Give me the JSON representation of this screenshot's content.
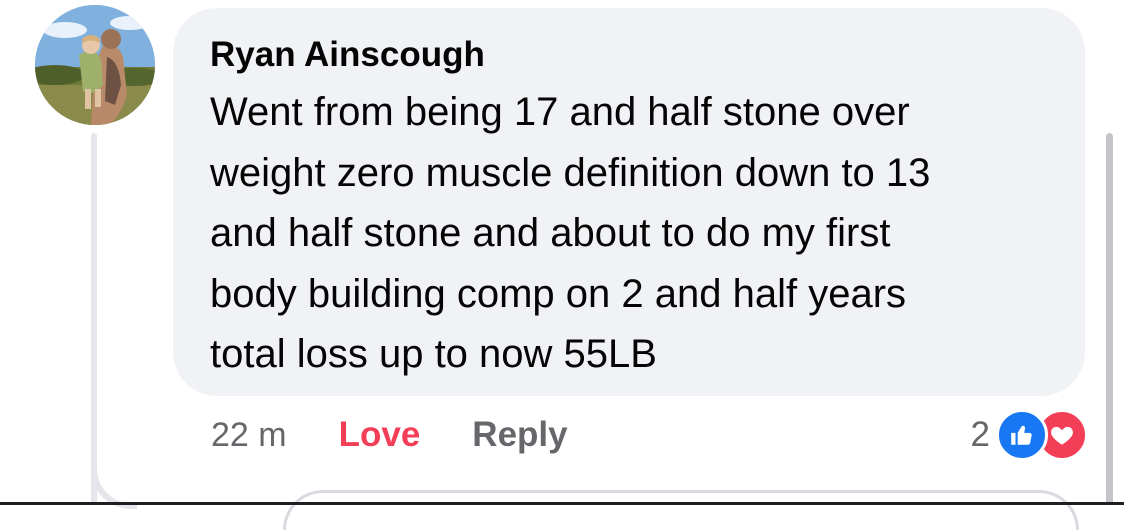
{
  "comment": {
    "author": "Ryan Ainscough",
    "text": "Went from being 17 and half stone over\nweight zero muscle definition down to 13\nand half stone and about to do my first\nbody building comp on 2 and half years\ntotal loss up to now 55LB",
    "timestamp": "22 m"
  },
  "actions": {
    "love_label": "Love",
    "reply_label": "Reply"
  },
  "reactions": {
    "count": "2",
    "types": [
      "like-icon",
      "love-icon"
    ]
  },
  "colors": {
    "bubble": "#f0f2f5",
    "love": "#f33e58",
    "like": "#1877f2",
    "secondary_text": "#65676b"
  }
}
